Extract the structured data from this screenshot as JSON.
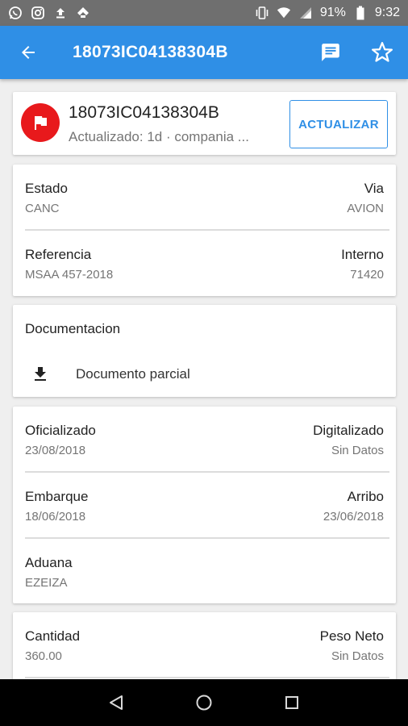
{
  "status_bar": {
    "battery_percent": "91%",
    "time": "9:32",
    "left_icons": [
      "whatsapp-icon",
      "instagram-icon",
      "upload-icon",
      "feedly-icon"
    ],
    "right_icons": [
      "vibrate-icon",
      "wifi-icon",
      "signal-icon",
      "battery-icon"
    ]
  },
  "app_bar": {
    "title": "18073IC04138304B",
    "background": "#2f8fe6"
  },
  "header": {
    "title": "18073IC04138304B",
    "subtitle": "Actualizado: 1d · compania ...",
    "update_label": "ACTUALIZAR",
    "flag_color": "#e8191c"
  },
  "general": {
    "estado_label": "Estado",
    "estado_value": "CANC",
    "via_label": "Via",
    "via_value": "AVION",
    "referencia_label": "Referencia",
    "referencia_value": "MSAA 457-2018",
    "interno_label": "Interno",
    "interno_value": "71420"
  },
  "documentacion": {
    "title": "Documentacion",
    "item_label": "Documento parcial"
  },
  "fechas": {
    "oficializado_label": "Oficializado",
    "oficializado_value": "23/08/2018",
    "digitalizado_label": "Digitalizado",
    "digitalizado_value": "Sin Datos",
    "embarque_label": "Embarque",
    "embarque_value": "18/06/2018",
    "arribo_label": "Arribo",
    "arribo_value": "23/06/2018",
    "aduana_label": "Aduana",
    "aduana_value": "EZEIZA"
  },
  "cantidades": {
    "cantidad_label": "Cantidad",
    "cantidad_value": "360.00",
    "peso_label": "Peso Neto",
    "peso_value": "Sin Datos"
  }
}
